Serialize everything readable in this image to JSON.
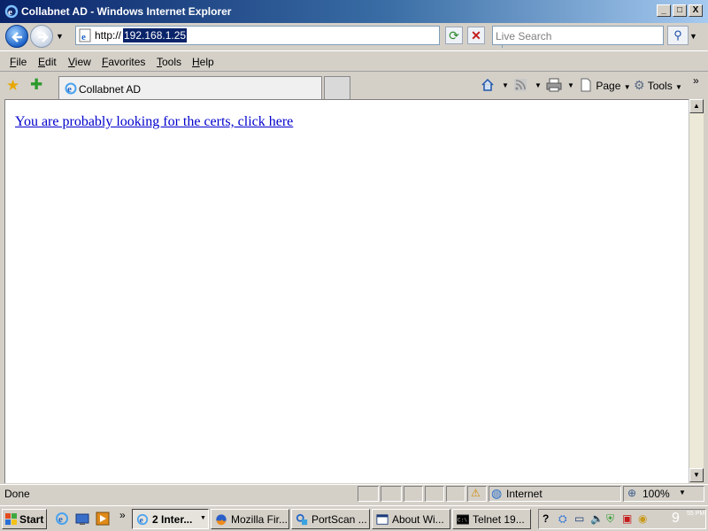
{
  "window": {
    "title": "Collabnet AD - Windows Internet Explorer",
    "controls": {
      "minimize": "_",
      "maximize": "□",
      "close": "X"
    }
  },
  "address_bar": {
    "prefix": "http://",
    "selected": "192.168.1.25",
    "search_placeholder": "Live Search"
  },
  "menu": [
    "File",
    "Edit",
    "View",
    "Favorites",
    "Tools",
    "Help"
  ],
  "tabs": [
    {
      "label": "Collabnet AD"
    }
  ],
  "command_bar": {
    "page": "Page",
    "tools": "Tools"
  },
  "content": {
    "link_text": "You are probably looking for the certs, click here"
  },
  "status": {
    "text": "Done",
    "zone": "Internet",
    "zoom": "100%"
  },
  "taskbar": {
    "start": "Start",
    "tasks": [
      {
        "label": "2 Inter...",
        "active": true
      },
      {
        "label": "Mozilla Fir..."
      },
      {
        "label": "PortScan ..."
      },
      {
        "label": "About Wi..."
      },
      {
        "label": "Telnet 19..."
      }
    ],
    "clock": "9",
    "clock_small": "55 PM"
  },
  "colors": {
    "title_active": "#0a246a",
    "link": "#0000cc",
    "selection": "#0a246a"
  },
  "icons": [
    "ie-icon",
    "back-icon",
    "forward-icon",
    "refresh-icon",
    "stop-icon",
    "search-icon",
    "favorites-star-icon",
    "add-favorite-icon",
    "home-icon",
    "feeds-icon",
    "print-icon",
    "page-icon",
    "gear-icon",
    "globe-icon",
    "zoom-icon"
  ]
}
